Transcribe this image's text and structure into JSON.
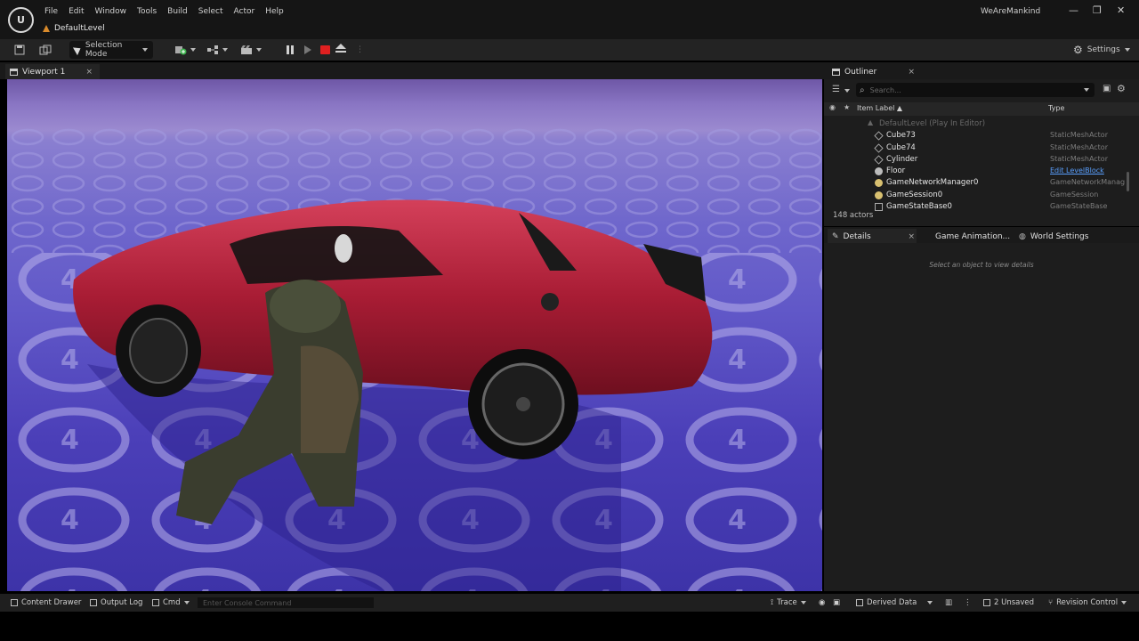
{
  "app": {
    "logo_text": "U",
    "menu": [
      "File",
      "Edit",
      "Window",
      "Tools",
      "Build",
      "Select",
      "Actor",
      "Help"
    ],
    "level_name": "DefaultLevel",
    "project_name": "WeAreMankind",
    "window_controls": [
      "—",
      "❐",
      "✕"
    ]
  },
  "toolbar": {
    "selection_mode": "Selection Mode",
    "settings": "Settings"
  },
  "viewport": {
    "tab_label": "Viewport 1",
    "close": "×"
  },
  "outliner": {
    "tab_label": "Outliner",
    "close": "×",
    "search_placeholder": "Search...",
    "col_label": "Item Label ▲",
    "col_type": "Type",
    "rows": [
      {
        "label": "DefaultLevel (Play In Editor)",
        "type": "",
        "icon": "level-icon",
        "head": true
      },
      {
        "label": "Cube73",
        "type": "StaticMeshActor",
        "icon": "cube-icon"
      },
      {
        "label": "Cube74",
        "type": "StaticMeshActor",
        "icon": "cube-icon"
      },
      {
        "label": "Cylinder",
        "type": "StaticMeshActor",
        "icon": "cube-icon"
      },
      {
        "label": "Floor",
        "type": "Edit LevelBlock",
        "icon": "sphere-icon",
        "link": true
      },
      {
        "label": "GameNetworkManager0",
        "type": "GameNetworkManag",
        "icon": "actor-icon"
      },
      {
        "label": "GameSession0",
        "type": "GameSession",
        "icon": "actor-icon"
      },
      {
        "label": "GameStateBase0",
        "type": "GameStateBase",
        "icon": "box-icon"
      }
    ],
    "actor_count": "148 actors"
  },
  "details": {
    "tab_label": "Details",
    "close": "×",
    "tab_game_animation": "Game Animation...",
    "tab_world_settings": "World Settings",
    "hint": "Select an object to view details"
  },
  "statusbar": {
    "content_drawer": "Content Drawer",
    "output_log": "Output Log",
    "cmd": "Cmd",
    "console_placeholder": "Enter Console Command",
    "trace": "Trace",
    "derived_data": "Derived Data",
    "unsaved": "2 Unsaved",
    "revision_control": "Revision Control"
  },
  "colors": {
    "stop": "#e02020",
    "car": "#b3203a",
    "floor": "#5a50c8",
    "link": "#5aa0ff"
  }
}
